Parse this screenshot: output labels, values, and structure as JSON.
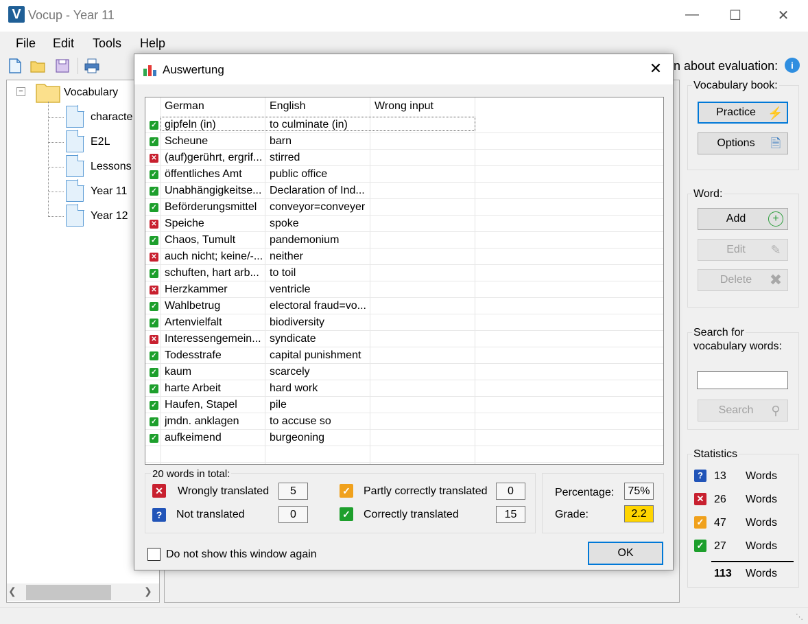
{
  "window": {
    "title": "Vocup - Year 11",
    "app_icon": "V"
  },
  "menu": [
    "File",
    "Edit",
    "Tools",
    "Help"
  ],
  "toolbar": {
    "icons": [
      "new-file-icon",
      "open-folder-icon",
      "save-icon",
      "print-icon"
    ],
    "info_text": "n about evaluation:"
  },
  "tree": {
    "root": "Vocabulary",
    "items": [
      "characte",
      "E2L",
      "Lessons",
      "Year 11",
      "Year 12"
    ]
  },
  "right_panel": {
    "vocab_book_label": "Vocabulary book:",
    "practice_label": "Practice",
    "options_label": "Options",
    "word_label": "Word:",
    "add_label": "Add",
    "edit_label": "Edit",
    "delete_label": "Delete",
    "search_label_1": "Search for",
    "search_label_2": "vocabulary words:",
    "search_value": "",
    "search_button": "Search",
    "statistics_label": "Statistics",
    "stats": [
      {
        "icon": "question-icon",
        "count": "13",
        "label": "Words"
      },
      {
        "icon": "wrong-icon",
        "count": "26",
        "label": "Words"
      },
      {
        "icon": "partly-correct-icon",
        "count": "47",
        "label": "Words"
      },
      {
        "icon": "correct-icon",
        "count": "27",
        "label": "Words"
      }
    ],
    "total_count": "113",
    "total_label": "Words"
  },
  "dialog": {
    "title": "Auswertung",
    "columns": [
      "German",
      "English",
      "Wrong input"
    ],
    "rows": [
      {
        "status": "ok",
        "german": "gipfeln (in)",
        "english": "to culminate (in)",
        "wrong": ""
      },
      {
        "status": "ok",
        "german": "Scheune",
        "english": "barn",
        "wrong": ""
      },
      {
        "status": "bad",
        "german": "(auf)gerührt, ergrif...",
        "english": "stirred",
        "wrong": ""
      },
      {
        "status": "ok",
        "german": "öffentliches Amt",
        "english": "public office",
        "wrong": ""
      },
      {
        "status": "ok",
        "german": "Unabhängigkeitse...",
        "english": "Declaration of Ind...",
        "wrong": ""
      },
      {
        "status": "ok",
        "german": "Beförderungsmittel",
        "english": "conveyor=conveyer",
        "wrong": ""
      },
      {
        "status": "bad",
        "german": "Speiche",
        "english": "spoke",
        "wrong": ""
      },
      {
        "status": "ok",
        "german": "Chaos, Tumult",
        "english": "pandemonium",
        "wrong": ""
      },
      {
        "status": "bad",
        "german": "auch nicht; keine/-...",
        "english": "neither",
        "wrong": ""
      },
      {
        "status": "ok",
        "german": "schuften, hart arb...",
        "english": "to toil",
        "wrong": ""
      },
      {
        "status": "bad",
        "german": "Herzkammer",
        "english": "ventricle",
        "wrong": ""
      },
      {
        "status": "ok",
        "german": "Wahlbetrug",
        "english": "electoral fraud=vo...",
        "wrong": ""
      },
      {
        "status": "ok",
        "german": "Artenvielfalt",
        "english": "biodiversity",
        "wrong": ""
      },
      {
        "status": "bad",
        "german": "Interessengemein...",
        "english": "syndicate",
        "wrong": ""
      },
      {
        "status": "ok",
        "german": "Todesstrafe",
        "english": "capital punishment",
        "wrong": ""
      },
      {
        "status": "ok",
        "german": "kaum",
        "english": "scarcely",
        "wrong": ""
      },
      {
        "status": "ok",
        "german": "harte Arbeit",
        "english": "hard work",
        "wrong": ""
      },
      {
        "status": "ok",
        "german": "Haufen, Stapel",
        "english": "pile",
        "wrong": ""
      },
      {
        "status": "ok",
        "german": "jmdn. anklagen",
        "english": "to accuse so",
        "wrong": ""
      },
      {
        "status": "ok",
        "german": "aufkeimend",
        "english": "burgeoning",
        "wrong": ""
      }
    ],
    "summary": {
      "total_text": "20 words in total:",
      "wrongly_label": "Wrongly translated",
      "wrongly_value": "5",
      "not_label": "Not translated",
      "not_value": "0",
      "partly_label": "Partly correctly translated",
      "partly_value": "0",
      "correct_label": "Correctly translated",
      "correct_value": "15",
      "percentage_label": "Percentage:",
      "percentage_value": "75%",
      "grade_label": "Grade:",
      "grade_value": "2.2"
    },
    "checkbox_label": "Do not show this window again",
    "ok_label": "OK"
  }
}
